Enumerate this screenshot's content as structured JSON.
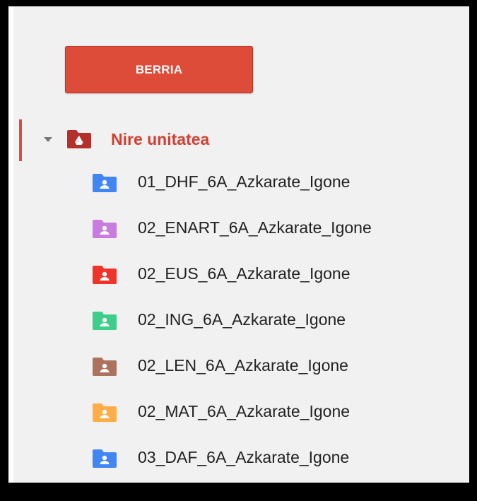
{
  "new_button": {
    "label": "BERRIA"
  },
  "root": {
    "label": "Nire unitatea",
    "color": "#b5302a",
    "icon": "google-drive-icon",
    "expanded": true
  },
  "folders": [
    {
      "name": "01_DHF_6A_Azkarate_Igone",
      "color": "#4285f4",
      "icon": "shared-folder-icon"
    },
    {
      "name": "02_ENART_6A_Azkarate_Igone",
      "color": "#c97be0",
      "icon": "shared-folder-icon"
    },
    {
      "name": "02_EUS_6A_Azkarate_Igone",
      "color": "#f0342a",
      "icon": "shared-folder-icon"
    },
    {
      "name": "02_ING_6A_Azkarate_Igone",
      "color": "#3dcf8a",
      "icon": "shared-folder-icon"
    },
    {
      "name": "02_LEN_6A_Azkarate_Igone",
      "color": "#ac725e",
      "icon": "shared-folder-icon"
    },
    {
      "name": "02_MAT_6A_Azkarate_Igone",
      "color": "#ffad46",
      "icon": "shared-folder-icon"
    },
    {
      "name": "03_DAF_6A_Azkarate_Igone",
      "color": "#4285f4",
      "icon": "shared-folder-icon"
    }
  ],
  "partial_folder_color": "#f691b2"
}
